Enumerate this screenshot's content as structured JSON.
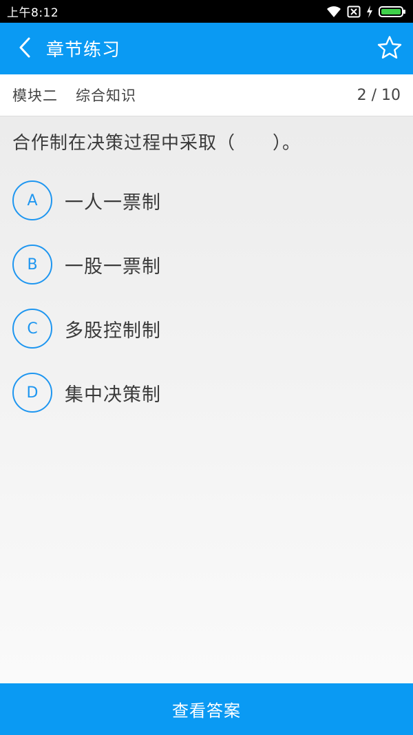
{
  "status_bar": {
    "time": "上午8:12",
    "icons": [
      "wifi-icon",
      "sim-disabled-icon",
      "charging-icon",
      "battery-icon"
    ]
  },
  "header": {
    "title": "章节练习",
    "back_icon": "chevron-left-icon",
    "favorite_icon": "star-outline-icon"
  },
  "module": {
    "name": "模块二",
    "topic": "综合知识",
    "counter": "2 / 10"
  },
  "question": {
    "text": "合作制在决策过程中采取（　　）。",
    "options": [
      {
        "letter": "A",
        "text": "一人一票制"
      },
      {
        "letter": "B",
        "text": "一股一票制"
      },
      {
        "letter": "C",
        "text": "多股控制制"
      },
      {
        "letter": "D",
        "text": "集中决策制"
      }
    ]
  },
  "footer": {
    "button_label": "查看答案"
  },
  "colors": {
    "accent": "#0a9af3",
    "option_ring": "#1e96f0"
  }
}
